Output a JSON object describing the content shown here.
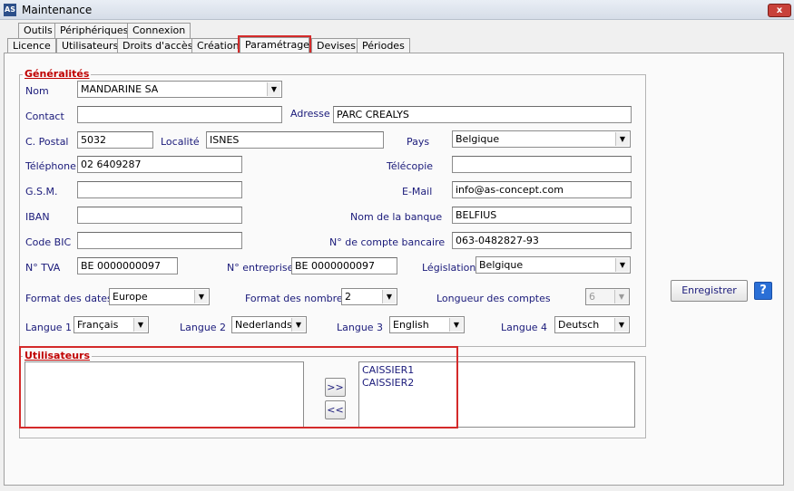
{
  "window": {
    "title": "Maintenance",
    "icon_text": "AS",
    "close_label": "x"
  },
  "tabs_row1": [
    "Outils",
    "Périphériques",
    "Connexion"
  ],
  "tabs_row2": [
    "Licence",
    "Utilisateurs",
    "Droits d'accès",
    "Création",
    "Paramétrage",
    "Devises",
    "Périodes"
  ],
  "active_tab": "Paramétrage",
  "generalites": {
    "legend": "Généralités",
    "nom": {
      "label": "Nom",
      "value": "MANDARINE SA"
    },
    "contact": {
      "label": "Contact",
      "value": ""
    },
    "adresse": {
      "label": "Adresse",
      "value": "PARC CREALYS"
    },
    "code_postal": {
      "label": "C. Postal",
      "value": "5032"
    },
    "localite": {
      "label": "Localité",
      "value": "ISNES"
    },
    "pays": {
      "label": "Pays",
      "value": "Belgique"
    },
    "telephone": {
      "label": "Téléphone",
      "value": "02 6409287"
    },
    "telecopie": {
      "label": "Télécopie",
      "value": ""
    },
    "gsm": {
      "label": "G.S.M.",
      "value": ""
    },
    "email": {
      "label": "E-Mail",
      "value": "info@as-concept.com"
    },
    "iban": {
      "label": "IBAN",
      "value": ""
    },
    "nom_banque": {
      "label": "Nom de la banque",
      "value": "BELFIUS"
    },
    "code_bic": {
      "label": "Code BIC",
      "value": ""
    },
    "compte_bancaire": {
      "label": "N° de compte bancaire",
      "value": "063-0482827-93"
    },
    "tva": {
      "label": "N°  TVA",
      "value": "BE 0000000097"
    },
    "entreprise": {
      "label": "N° entreprise",
      "value": "BE 0000000097"
    },
    "legislation": {
      "label": "Législation",
      "value": "Belgique"
    },
    "format_dates": {
      "label": "Format des dates",
      "value": "Europe"
    },
    "format_nombres": {
      "label": "Format des nombres",
      "value": "2"
    },
    "longueur_comptes": {
      "label": "Longueur des comptes",
      "value": "6"
    },
    "langue1": {
      "label": "Langue 1",
      "value": "Français"
    },
    "langue2": {
      "label": "Langue 2",
      "value": "Nederlands"
    },
    "langue3": {
      "label": "Langue 3",
      "value": "English"
    },
    "langue4": {
      "label": "Langue 4",
      "value": "Deutsch"
    }
  },
  "utilisateurs": {
    "legend": "Utilisateurs",
    "available": [],
    "selected": [
      "CAISSIER1",
      "CAISSIER2"
    ],
    "add_label": ">>",
    "remove_label": "<<"
  },
  "enregistrer_label": "Enregistrer",
  "help_label": "?",
  "colors": {
    "accent_red": "#d42a2a",
    "label_blue": "#1a1a7a",
    "help_blue": "#2a6fd6"
  }
}
